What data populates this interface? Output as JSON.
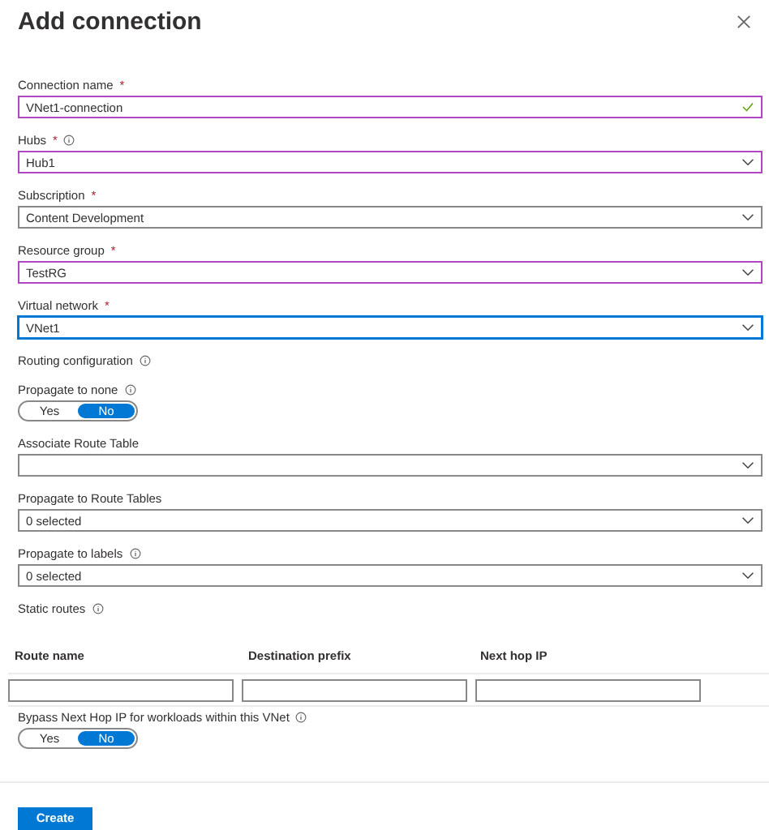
{
  "title": "Add connection",
  "form": [
    {
      "kind": "input",
      "label": "Connection name",
      "required_mark": "*",
      "info": false,
      "value": "VNet1-connection",
      "edited": true,
      "focused": false,
      "valid": true
    },
    {
      "kind": "select",
      "label": "Hubs",
      "required_mark": "*",
      "info": true,
      "value": "Hub1",
      "edited": true,
      "focused": false
    },
    {
      "kind": "select",
      "label": "Subscription",
      "required_mark": "*",
      "info": false,
      "value": "Content Development",
      "edited": false,
      "focused": false
    },
    {
      "kind": "select",
      "label": "Resource group",
      "required_mark": "*",
      "info": false,
      "value": "TestRG",
      "edited": true,
      "focused": false
    },
    {
      "kind": "select",
      "label": "Virtual network",
      "required_mark": "*",
      "info": false,
      "value": "VNet1",
      "edited": false,
      "focused": true
    },
    {
      "kind": "heading",
      "label": "Routing configuration",
      "info": true
    },
    {
      "kind": "toggle",
      "label": "Propagate to none",
      "info": true,
      "options": [
        {
          "label": "Yes",
          "selected": false
        },
        {
          "label": "No",
          "selected": true
        }
      ]
    },
    {
      "kind": "select",
      "label": "Associate Route Table",
      "info": false,
      "edited": false,
      "focused": false
    },
    {
      "kind": "select",
      "label": "Propagate to Route Tables",
      "info": false,
      "value": "0 selected",
      "edited": false,
      "focused": false
    },
    {
      "kind": "select",
      "label": "Propagate to labels",
      "info": true,
      "value": "0 selected",
      "edited": false,
      "focused": false
    },
    {
      "kind": "heading",
      "label": "Static routes",
      "info": true
    },
    {
      "kind": "routes",
      "columns": [
        "Route name",
        "Destination prefix",
        "Next hop IP"
      ]
    },
    {
      "kind": "toggle",
      "label": "Bypass Next Hop IP for workloads within this VNet",
      "info": true,
      "options": [
        {
          "label": "Yes",
          "selected": false
        },
        {
          "label": "No",
          "selected": true
        }
      ]
    }
  ],
  "create_button": {
    "label": "Create"
  }
}
